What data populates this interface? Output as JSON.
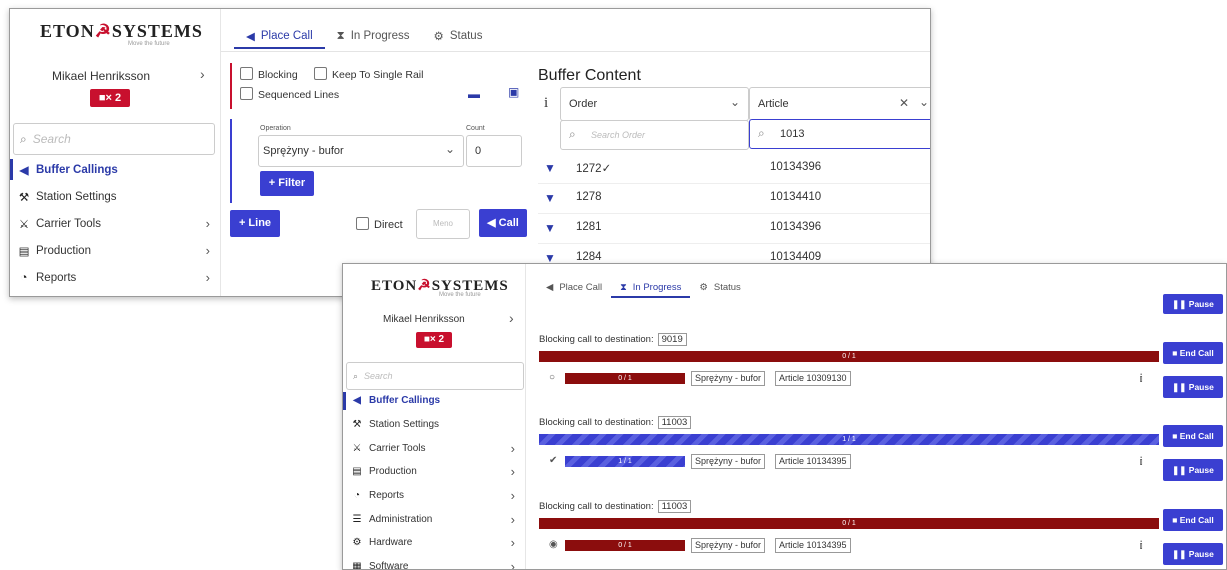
{
  "brand": {
    "name_left": "ETON",
    "name_right": "SYSTEMS",
    "tagline": "Move the future"
  },
  "colors": {
    "primary": "#3a3fd1",
    "brand_red": "#c8102e",
    "dark_red": "#8b0d0d"
  },
  "window1": {
    "user": "Mikael Henriksson",
    "badge": "× 2",
    "search_placeholder": "Search",
    "nav": [
      "Buffer Callings",
      "Station Settings",
      "Carrier Tools",
      "Production",
      "Reports"
    ],
    "tabs": [
      "Place Call",
      "In Progress",
      "Status"
    ],
    "options": {
      "blocking": "Blocking",
      "single_rail": "Keep To Single Rail",
      "sequenced": "Sequenced Lines"
    },
    "operation": {
      "label": "Operation",
      "value": "Sprężyny - bufor"
    },
    "count": {
      "label": "Count",
      "value": "0"
    },
    "filter_btn": "Filter",
    "line_btn": "Line",
    "direct": "Direct",
    "meno_placeholder": "Meno",
    "call_btn": "Call",
    "buffer": {
      "title": "Buffer Content",
      "info": "i",
      "col_order": "Order",
      "col_article": "Article",
      "search_order_placeholder": "Search Order",
      "article_filter": "1013",
      "rows": [
        {
          "order": "1272✓",
          "article": "10134396"
        },
        {
          "order": "1278",
          "article": "10134410"
        },
        {
          "order": "1281",
          "article": "10134396"
        },
        {
          "order": "1284",
          "article": "10134409"
        }
      ]
    }
  },
  "window2": {
    "user": "Mikael Henriksson",
    "badge": "× 2",
    "search_placeholder": "Search",
    "nav": [
      "Buffer Callings",
      "Station Settings",
      "Carrier Tools",
      "Production",
      "Reports",
      "Administration",
      "Hardware",
      "Software"
    ],
    "tabs": [
      "Place Call",
      "In Progress",
      "Status"
    ],
    "top_button": "Pause",
    "calls": [
      {
        "label": "Blocking call to destination:",
        "dest": "9019",
        "main_bar": "0 / 1",
        "sub_bar": "0 / 1",
        "operation": "Sprężyny - bufor",
        "article": "Article 10309130",
        "end": "End Call",
        "pause": "Pause",
        "progress": 0
      },
      {
        "label": "Blocking call to destination:",
        "dest": "11003",
        "main_bar": "1 / 1",
        "sub_bar": "1 / 1",
        "operation": "Sprężyny - bufor",
        "article": "Article 10134395",
        "end": "End Call",
        "pause": "Pause",
        "progress": 1
      },
      {
        "label": "Blocking call to destination:",
        "dest": "11003",
        "main_bar": "0 / 1",
        "sub_bar": "0 / 1",
        "operation": "Sprężyny - bufor",
        "article": "Article 10134395",
        "end": "End Call",
        "pause": "Pause",
        "progress": 0
      }
    ]
  }
}
